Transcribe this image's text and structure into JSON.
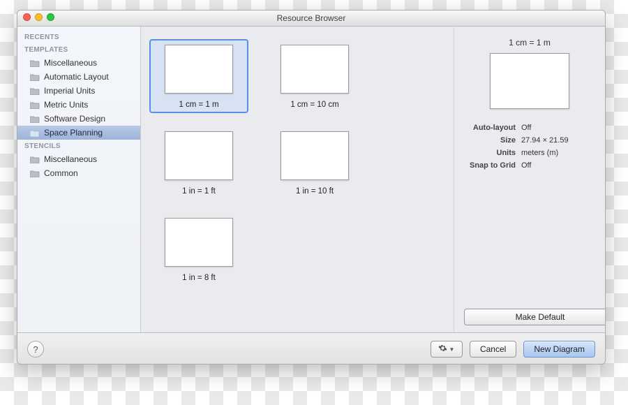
{
  "window": {
    "title": "Resource Browser"
  },
  "sidebar": {
    "sections": [
      {
        "heading": "RECENTS",
        "items": []
      },
      {
        "heading": "TEMPLATES",
        "items": [
          {
            "label": "Miscellaneous"
          },
          {
            "label": "Automatic Layout"
          },
          {
            "label": "Imperial Units"
          },
          {
            "label": "Metric Units"
          },
          {
            "label": "Software Design"
          },
          {
            "label": "Space Planning"
          }
        ],
        "selected_index": 5
      },
      {
        "heading": "STENCILS",
        "items": [
          {
            "label": "Miscellaneous"
          },
          {
            "label": "Common"
          }
        ]
      }
    ]
  },
  "templates": {
    "selected_index": 0,
    "items": [
      {
        "label": "1 cm = 1 m"
      },
      {
        "label": "1 cm = 10 cm"
      },
      {
        "label": "1 in = 1 ft"
      },
      {
        "label": "1 in = 10 ft"
      },
      {
        "label": "1 in = 8 ft"
      }
    ]
  },
  "details": {
    "title": "1 cm = 1 m",
    "props": {
      "auto_layout": {
        "label": "Auto-layout",
        "value": "Off"
      },
      "size": {
        "label": "Size",
        "value": "27.94 × 21.59"
      },
      "units": {
        "label": "Units",
        "value": "meters (m)"
      },
      "snap": {
        "label": "Snap to Grid",
        "value": "Off"
      }
    },
    "make_default_label": "Make Default"
  },
  "footer": {
    "cancel_label": "Cancel",
    "confirm_label": "New Diagram"
  }
}
